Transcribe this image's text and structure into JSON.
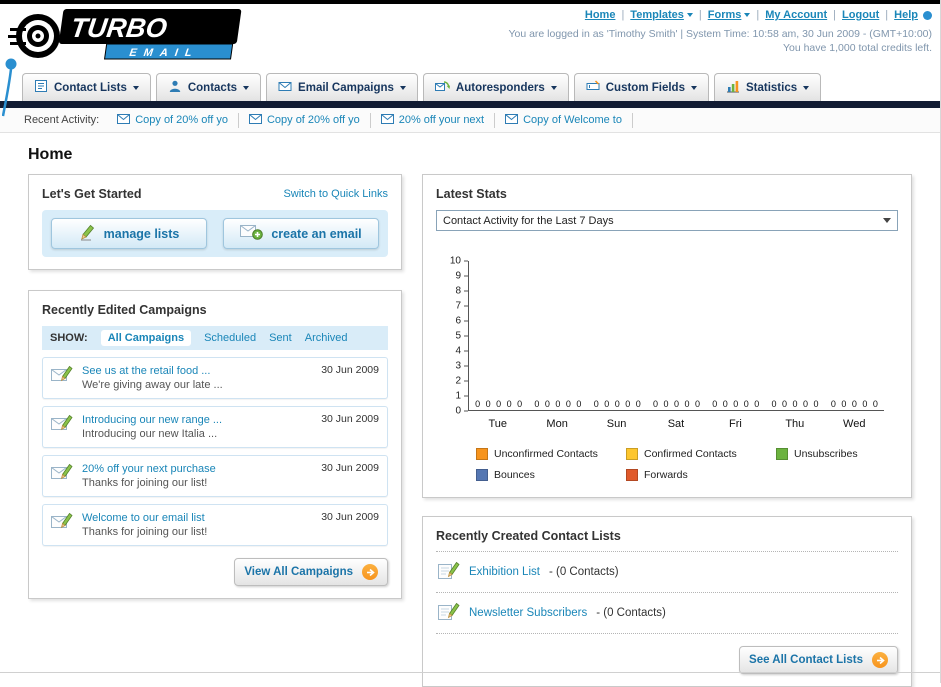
{
  "theme": {
    "link_color": "#1a86b8",
    "accent_orange": "#f7941d",
    "nav_bar_color": "#121c33",
    "logo_blue": "#2a8fd0"
  },
  "header": {
    "logo_title": "TURBO",
    "logo_subtitle": "EMAIL",
    "links": [
      {
        "label": "Home",
        "has_menu": false
      },
      {
        "label": "Templates",
        "has_menu": true
      },
      {
        "label": "Forms",
        "has_menu": true
      },
      {
        "label": "My Account",
        "has_menu": false
      },
      {
        "label": "Logout",
        "has_menu": false
      },
      {
        "label": "Help",
        "has_menu": false
      }
    ],
    "login_info": "You are logged in as 'Timothy Smith' | System Time: 10:58 am, 30 Jun 2009 - (GMT+10:00)",
    "credits_info": "You have 1,000 total credits left."
  },
  "nav": {
    "tabs": [
      {
        "label": "Contact Lists",
        "icon": "contact-lists-icon"
      },
      {
        "label": "Contacts",
        "icon": "contacts-icon"
      },
      {
        "label": "Email Campaigns",
        "icon": "email-campaigns-icon"
      },
      {
        "label": "Autoresponders",
        "icon": "autoresponders-icon"
      },
      {
        "label": "Custom Fields",
        "icon": "custom-fields-icon"
      },
      {
        "label": "Statistics",
        "icon": "statistics-icon"
      }
    ]
  },
  "activity": {
    "label": "Recent Activity:",
    "items": [
      {
        "text": "Copy of 20% off yo"
      },
      {
        "text": "Copy of 20% off yo"
      },
      {
        "text": "20% off your next"
      },
      {
        "text": "Copy of Welcome to"
      }
    ]
  },
  "page": {
    "title": "Home"
  },
  "get_started": {
    "title": "Let's Get Started",
    "switch_link": "Switch to Quick Links",
    "manage_lists_label": "manage lists",
    "create_email_label": "create an email"
  },
  "campaigns": {
    "title": "Recently Edited Campaigns",
    "show_label": "SHOW:",
    "filters": [
      {
        "label": "All Campaigns",
        "active": true
      },
      {
        "label": "Scheduled",
        "active": false
      },
      {
        "label": "Sent",
        "active": false
      },
      {
        "label": "Archived",
        "active": false
      }
    ],
    "items": [
      {
        "title": "See us at the retail food ...",
        "subtitle": "We're giving away our late ...",
        "date": "30 Jun 2009"
      },
      {
        "title": "Introducing our new range ...",
        "subtitle": "Introducing our new Italia ...",
        "date": "30 Jun 2009"
      },
      {
        "title": "20% off your next purchase",
        "subtitle": "Thanks for joining our list!",
        "date": "30 Jun 2009"
      },
      {
        "title": "Welcome to our email list",
        "subtitle": "Thanks for joining our list!",
        "date": "30 Jun 2009"
      }
    ],
    "view_all_label": "View All Campaigns"
  },
  "stats": {
    "title": "Latest Stats",
    "selected_option": "Contact Activity for the Last 7 Days",
    "chart_data": {
      "type": "bar",
      "title": "Contact Activity for the Last 7 Days",
      "categories": [
        "Tue",
        "Mon",
        "Sun",
        "Sat",
        "Fri",
        "Thu",
        "Wed"
      ],
      "series": [
        {
          "name": "Unconfirmed Contacts",
          "color": "#f7941d",
          "values": [
            0,
            0,
            0,
            0,
            0,
            0,
            0
          ]
        },
        {
          "name": "Confirmed Contacts",
          "color": "#fdc62e",
          "values": [
            0,
            0,
            0,
            0,
            0,
            0,
            0
          ]
        },
        {
          "name": "Unsubscribes",
          "color": "#6cb33f",
          "values": [
            0,
            0,
            0,
            0,
            0,
            0,
            0
          ]
        },
        {
          "name": "Bounces",
          "color": "#5577b3",
          "values": [
            0,
            0,
            0,
            0,
            0,
            0,
            0
          ]
        },
        {
          "name": "Forwards",
          "color": "#e05a2b",
          "values": [
            0,
            0,
            0,
            0,
            0,
            0,
            0
          ]
        }
      ],
      "ylim": [
        0,
        10
      ],
      "yticks": [
        0,
        1,
        2,
        3,
        4,
        5,
        6,
        7,
        8,
        9,
        10
      ],
      "grid": false,
      "legend_position": "bottom",
      "value_labels_shown": true
    }
  },
  "contact_lists": {
    "title": "Recently Created Contact Lists",
    "items": [
      {
        "name": "Exhibition List",
        "detail": "- (0 Contacts)"
      },
      {
        "name": "Newsletter Subscribers",
        "detail": "- (0 Contacts)"
      }
    ],
    "see_all_label": "See All Contact Lists"
  }
}
